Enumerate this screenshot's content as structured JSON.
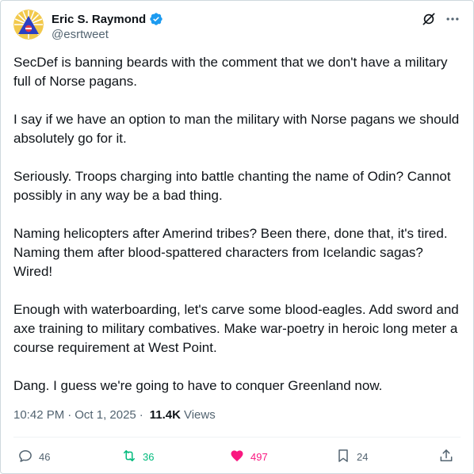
{
  "author": {
    "name": "Eric S. Raymond",
    "handle": "@esrtweet"
  },
  "tweet": {
    "paragraphs": [
      "SecDef is banning beards with the comment that we don't have a military full of Norse pagans.",
      "I say if we have an option to man the military with Norse pagans we should absolutely go for it.",
      "Seriously. Troops charging into battle chanting the name of Odin? Cannot possibly in any way be a bad thing.",
      "Naming helicopters after Amerind tribes? Been there, done that, it's tired. Naming them after blood-spattered characters from Icelandic sagas? Wired!",
      "Enough with waterboarding, let's carve some blood-eagles. Add sword and axe training to military combatives. Make war-poetry in heroic long meter a course requirement at West Point.",
      "Dang. I guess we're going to have to conquer Greenland now."
    ],
    "time": "10:42 PM",
    "date": "Oct 1, 2025",
    "views_count": "11.4K",
    "views_label": "Views"
  },
  "actions": {
    "replies": "46",
    "reposts": "36",
    "likes": "497",
    "bookmarks": "24"
  },
  "icons": {
    "verified": "verified-badge-icon",
    "grok": "grok-icon",
    "more": "more-icon",
    "reply": "reply-icon",
    "repost": "repost-icon",
    "like": "heart-icon",
    "bookmark": "bookmark-icon",
    "share": "share-icon"
  },
  "colors": {
    "verified": "#1d9bf0",
    "repost": "#00ba7c",
    "like": "#f91880",
    "secondary_text": "#536471"
  }
}
